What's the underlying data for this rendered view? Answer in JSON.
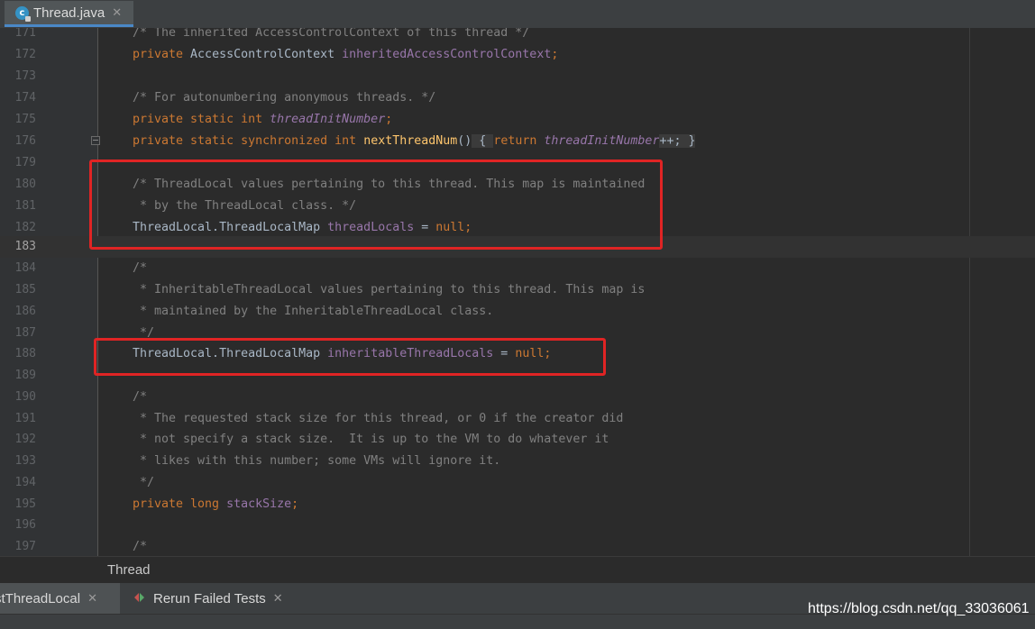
{
  "tab": {
    "title": "Thread.java",
    "icon": "java-class-icon",
    "close": "✕",
    "icon_letter": "c"
  },
  "lines": [
    {
      "num": "171",
      "c1": "/* The inherited AccessControlContext of this thread */"
    },
    {
      "num": "172",
      "k1": "private ",
      "t1": "AccessControlContext ",
      "f1": "inheritedAccessControlContext",
      "t2": ";"
    },
    {
      "num": "173"
    },
    {
      "num": "174",
      "c1": "/* For autonumbering anonymous threads. */"
    },
    {
      "num": "175",
      "k1": "private static int ",
      "fi1": "threadInitNumber",
      "t1": ";"
    },
    {
      "num": "176",
      "k1": "private static synchronized int ",
      "m1": "nextThreadNum",
      "t1": "()",
      "i1": " { ",
      "k2": "return ",
      "fi1": "threadInitNumber",
      "i2": "++; }"
    },
    {
      "num": "179"
    },
    {
      "num": "180",
      "c1": "/* ThreadLocal values pertaining to this thread. This map is maintained"
    },
    {
      "num": "181",
      "c1": " * by the ThreadLocal class. */"
    },
    {
      "num": "182",
      "t1": "ThreadLocal.ThreadLocalMap ",
      "f1": "threadLocals",
      "t2": " = ",
      "k1": "null",
      "k2": ";"
    },
    {
      "num": "183"
    },
    {
      "num": "184",
      "c1": "/*"
    },
    {
      "num": "185",
      "c1": " * InheritableThreadLocal values pertaining to this thread. This map is"
    },
    {
      "num": "186",
      "c1": " * maintained by the InheritableThreadLocal class."
    },
    {
      "num": "187",
      "c1": " */"
    },
    {
      "num": "188",
      "t1": "ThreadLocal.ThreadLocalMap ",
      "f1": "inheritableThreadLocals",
      "t2": " = ",
      "k1": "null",
      "k2": ";"
    },
    {
      "num": "189"
    },
    {
      "num": "190",
      "c1": "/*"
    },
    {
      "num": "191",
      "c1": " * The requested stack size for this thread, or 0 if the creator did"
    },
    {
      "num": "192",
      "c1": " * not specify a stack size.  It is up to the VM to do whatever it"
    },
    {
      "num": "193",
      "c1": " * likes with this number; some VMs will ignore it."
    },
    {
      "num": "194",
      "c1": " */"
    },
    {
      "num": "195",
      "k1": "private long ",
      "f1": "stackSize",
      "t1": ";"
    },
    {
      "num": "196"
    },
    {
      "num": "197",
      "c1": "/*"
    }
  ],
  "breadcrumb": "Thread",
  "bottom_tabs": {
    "test_tab": "stThreadLocal",
    "rerun": "Rerun Failed Tests",
    "close": "✕"
  },
  "watermark": "https://blog.csdn.net/qq_33036061",
  "colors": {
    "highlight_box": "#e02424",
    "keyword": "#cc7832",
    "field": "#9876aa",
    "comment": "#808080"
  }
}
